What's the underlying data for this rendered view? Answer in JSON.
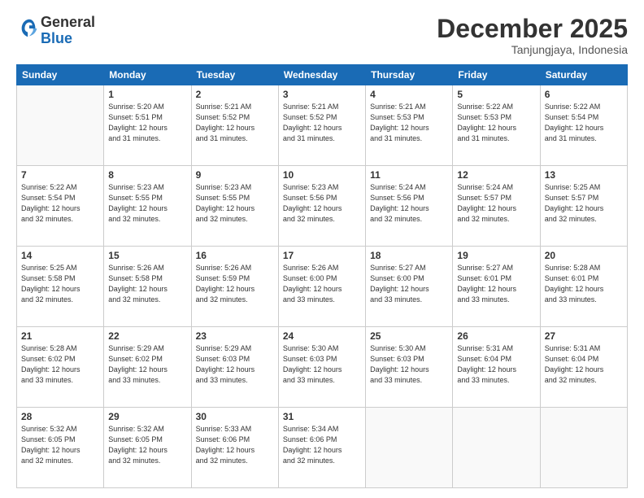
{
  "header": {
    "logo_general": "General",
    "logo_blue": "Blue",
    "month_title": "December 2025",
    "location": "Tanjungjaya, Indonesia"
  },
  "calendar": {
    "days_of_week": [
      "Sunday",
      "Monday",
      "Tuesday",
      "Wednesday",
      "Thursday",
      "Friday",
      "Saturday"
    ],
    "weeks": [
      [
        {
          "day": "",
          "info": ""
        },
        {
          "day": "1",
          "info": "Sunrise: 5:20 AM\nSunset: 5:51 PM\nDaylight: 12 hours\nand 31 minutes."
        },
        {
          "day": "2",
          "info": "Sunrise: 5:21 AM\nSunset: 5:52 PM\nDaylight: 12 hours\nand 31 minutes."
        },
        {
          "day": "3",
          "info": "Sunrise: 5:21 AM\nSunset: 5:52 PM\nDaylight: 12 hours\nand 31 minutes."
        },
        {
          "day": "4",
          "info": "Sunrise: 5:21 AM\nSunset: 5:53 PM\nDaylight: 12 hours\nand 31 minutes."
        },
        {
          "day": "5",
          "info": "Sunrise: 5:22 AM\nSunset: 5:53 PM\nDaylight: 12 hours\nand 31 minutes."
        },
        {
          "day": "6",
          "info": "Sunrise: 5:22 AM\nSunset: 5:54 PM\nDaylight: 12 hours\nand 31 minutes."
        }
      ],
      [
        {
          "day": "7",
          "info": "Sunrise: 5:22 AM\nSunset: 5:54 PM\nDaylight: 12 hours\nand 32 minutes."
        },
        {
          "day": "8",
          "info": "Sunrise: 5:23 AM\nSunset: 5:55 PM\nDaylight: 12 hours\nand 32 minutes."
        },
        {
          "day": "9",
          "info": "Sunrise: 5:23 AM\nSunset: 5:55 PM\nDaylight: 12 hours\nand 32 minutes."
        },
        {
          "day": "10",
          "info": "Sunrise: 5:23 AM\nSunset: 5:56 PM\nDaylight: 12 hours\nand 32 minutes."
        },
        {
          "day": "11",
          "info": "Sunrise: 5:24 AM\nSunset: 5:56 PM\nDaylight: 12 hours\nand 32 minutes."
        },
        {
          "day": "12",
          "info": "Sunrise: 5:24 AM\nSunset: 5:57 PM\nDaylight: 12 hours\nand 32 minutes."
        },
        {
          "day": "13",
          "info": "Sunrise: 5:25 AM\nSunset: 5:57 PM\nDaylight: 12 hours\nand 32 minutes."
        }
      ],
      [
        {
          "day": "14",
          "info": "Sunrise: 5:25 AM\nSunset: 5:58 PM\nDaylight: 12 hours\nand 32 minutes."
        },
        {
          "day": "15",
          "info": "Sunrise: 5:26 AM\nSunset: 5:58 PM\nDaylight: 12 hours\nand 32 minutes."
        },
        {
          "day": "16",
          "info": "Sunrise: 5:26 AM\nSunset: 5:59 PM\nDaylight: 12 hours\nand 32 minutes."
        },
        {
          "day": "17",
          "info": "Sunrise: 5:26 AM\nSunset: 6:00 PM\nDaylight: 12 hours\nand 33 minutes."
        },
        {
          "day": "18",
          "info": "Sunrise: 5:27 AM\nSunset: 6:00 PM\nDaylight: 12 hours\nand 33 minutes."
        },
        {
          "day": "19",
          "info": "Sunrise: 5:27 AM\nSunset: 6:01 PM\nDaylight: 12 hours\nand 33 minutes."
        },
        {
          "day": "20",
          "info": "Sunrise: 5:28 AM\nSunset: 6:01 PM\nDaylight: 12 hours\nand 33 minutes."
        }
      ],
      [
        {
          "day": "21",
          "info": "Sunrise: 5:28 AM\nSunset: 6:02 PM\nDaylight: 12 hours\nand 33 minutes."
        },
        {
          "day": "22",
          "info": "Sunrise: 5:29 AM\nSunset: 6:02 PM\nDaylight: 12 hours\nand 33 minutes."
        },
        {
          "day": "23",
          "info": "Sunrise: 5:29 AM\nSunset: 6:03 PM\nDaylight: 12 hours\nand 33 minutes."
        },
        {
          "day": "24",
          "info": "Sunrise: 5:30 AM\nSunset: 6:03 PM\nDaylight: 12 hours\nand 33 minutes."
        },
        {
          "day": "25",
          "info": "Sunrise: 5:30 AM\nSunset: 6:03 PM\nDaylight: 12 hours\nand 33 minutes."
        },
        {
          "day": "26",
          "info": "Sunrise: 5:31 AM\nSunset: 6:04 PM\nDaylight: 12 hours\nand 33 minutes."
        },
        {
          "day": "27",
          "info": "Sunrise: 5:31 AM\nSunset: 6:04 PM\nDaylight: 12 hours\nand 32 minutes."
        }
      ],
      [
        {
          "day": "28",
          "info": "Sunrise: 5:32 AM\nSunset: 6:05 PM\nDaylight: 12 hours\nand 32 minutes."
        },
        {
          "day": "29",
          "info": "Sunrise: 5:32 AM\nSunset: 6:05 PM\nDaylight: 12 hours\nand 32 minutes."
        },
        {
          "day": "30",
          "info": "Sunrise: 5:33 AM\nSunset: 6:06 PM\nDaylight: 12 hours\nand 32 minutes."
        },
        {
          "day": "31",
          "info": "Sunrise: 5:34 AM\nSunset: 6:06 PM\nDaylight: 12 hours\nand 32 minutes."
        },
        {
          "day": "",
          "info": ""
        },
        {
          "day": "",
          "info": ""
        },
        {
          "day": "",
          "info": ""
        }
      ]
    ]
  }
}
